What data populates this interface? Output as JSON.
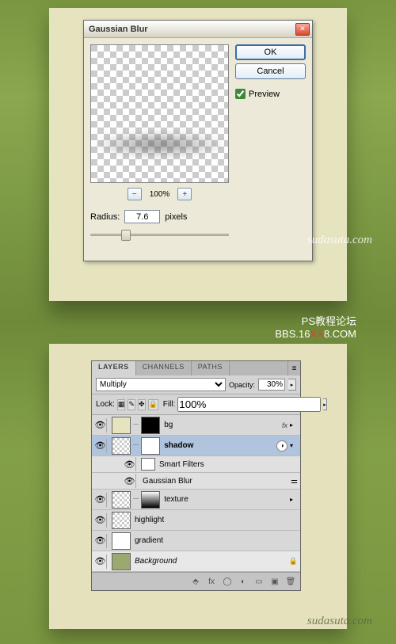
{
  "dialog": {
    "title": "Gaussian Blur",
    "ok": "OK",
    "cancel": "Cancel",
    "preview_label": "Preview",
    "zoom": "100%",
    "radius_label": "Radius:",
    "radius_value": "7.6",
    "radius_unit": "pixels"
  },
  "watermark": "sudasuta.com",
  "forum": {
    "line1": "PS教程论坛",
    "line2a": "BBS.16",
    "line2b": "XX",
    "line2c": "8.COM"
  },
  "panel": {
    "tabs": {
      "layers": "LAYERS",
      "channels": "CHANNELS",
      "paths": "PATHS"
    },
    "blend_mode": "Multiply",
    "opacity_label": "Opacity:",
    "opacity_value": "30%",
    "lock_label": "Lock:",
    "fill_label": "Fill:",
    "fill_value": "100%",
    "layers": {
      "bg": "bg",
      "shadow": "shadow",
      "smart_filters": "Smart Filters",
      "gaussian": "Gaussian Blur",
      "texture": "texture",
      "highlight": "highlight",
      "gradient": "gradient",
      "background": "Background"
    },
    "fx": "fx"
  }
}
